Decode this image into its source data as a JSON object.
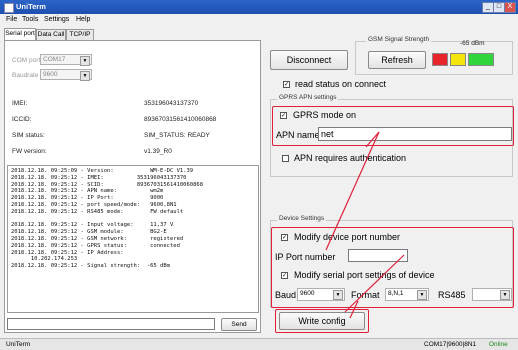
{
  "window": {
    "title": "UniTerm",
    "min": "_",
    "max": "□",
    "close": "X"
  },
  "menu": [
    "File",
    "Tools",
    "Settings",
    "Help"
  ],
  "tabs": [
    "Serial port",
    "Data Call",
    "TCP/IP"
  ],
  "serial": {
    "com_label": "COM port",
    "com_value": "COM17",
    "baud_label": "Baudrate",
    "baud_value": "9600"
  },
  "info": [
    {
      "label": "IMEI:",
      "value": "353196043137370"
    },
    {
      "label": "ICCID:",
      "value": "89367031561410060868"
    },
    {
      "label": "SIM status:",
      "value": "SIM_STATUS: READY"
    },
    {
      "label": "FW version:",
      "value": "v1.39_R0"
    }
  ],
  "log": [
    "2018.12.18. 09:25:09 - Version:           WM-E-DC V1.39",
    "2018.12.18. 09:25:12 - IMEI:          353196043137370",
    "2018.12.18. 09:25:12 - SCID:          89367031561410060868",
    "",
    "2018.12.18. 09:25:12 - APN name:          wm2m",
    "2018.12.18. 09:25:12 - IP Port:           9000",
    "2018.12.18. 09:25:12 - port speed/mode:   9600,8N1",
    "2018.12.18. 09:25:12 - RS485 mode:        FW default",
    "",
    "2018.12.18. 09:25:12 - Input voltage:     11,37 V",
    "2018.12.18. 09:25:12 - GSM module:        BG2-E",
    "2018.12.18. 09:25:12 - GSM network:       registered",
    "2018.12.18. 09:25:12 - GPRS status:       connected",
    "2018.12.18. 09:25:12 - IP Address:",
    "      10.202.174.253",
    "2018.12.18. 09:25:12 - Signal strength:  -65 dBm"
  ],
  "send": {
    "value": "",
    "label": "Send"
  },
  "disconnect_label": "Disconnect",
  "signal": {
    "caption": "GSM Signal Strength",
    "value": "-65 dBm",
    "refresh_label": "Refresh",
    "colors": [
      "#e8252a",
      "#f4e60c",
      "#2fd53b"
    ]
  },
  "read_status": {
    "label": "read status on connect",
    "checked": true
  },
  "gprs": {
    "caption": "GPRS APN settings",
    "mode_label": "GPRS mode on",
    "mode_checked": true,
    "apn_label": "APN name",
    "apn_value": "net",
    "auth_label": "APN requires authentication",
    "auth_checked": false
  },
  "device": {
    "caption": "Device Settings",
    "modify_port_label": "Modify device port number",
    "modify_port_checked": true,
    "ip_port_label": "IP Port number",
    "ip_port_value": "",
    "modify_serial_label": "Modify serial port settings of device",
    "modify_serial_checked": true,
    "baud_label": "Baud",
    "baud_value": "9600",
    "format_label": "Format",
    "format_value": "8,N,1",
    "rs485_label": "RS485",
    "rs485_value": ""
  },
  "write_config_label": "Write config",
  "status": {
    "left": "UniTerm",
    "port": "COM17|9600|8N1",
    "state": "Online"
  },
  "accent": "#e0203a"
}
